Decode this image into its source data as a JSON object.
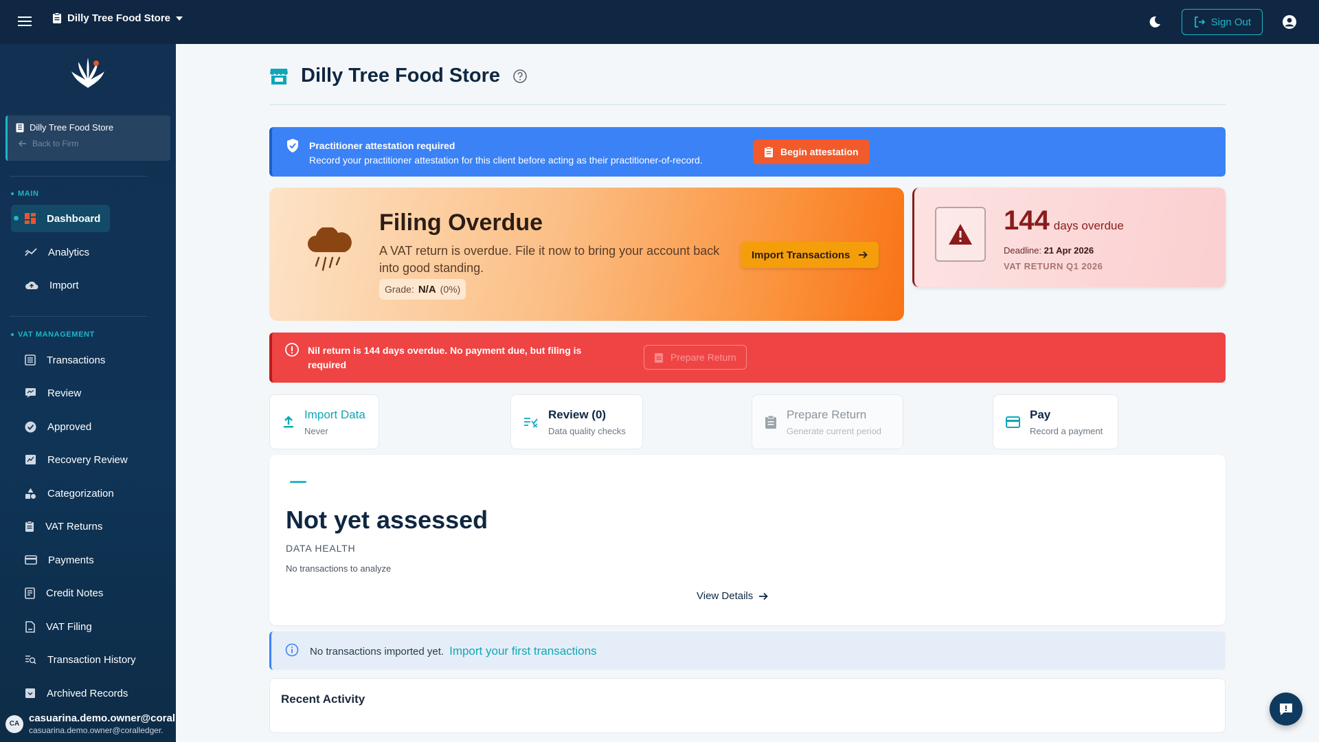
{
  "topbar": {
    "store_name": "Dilly Tree Food Store",
    "sign_out_label": "Sign Out"
  },
  "sidebar": {
    "client_name": "Dilly Tree Food Store",
    "back_label": "Back to Firm",
    "main_section": "MAIN",
    "main_items": [
      {
        "label": "Dashboard",
        "icon": "dashboard-icon"
      },
      {
        "label": "Analytics",
        "icon": "analytics-icon"
      },
      {
        "label": "Import",
        "icon": "cloud-upload-icon"
      }
    ],
    "vat_section": "VAT MANAGEMENT",
    "vat_items": [
      {
        "label": "Transactions",
        "icon": "list-icon"
      },
      {
        "label": "Review",
        "icon": "review-icon"
      },
      {
        "label": "Approved",
        "icon": "check-circle-icon"
      },
      {
        "label": "Recovery Review",
        "icon": "recovery-icon"
      },
      {
        "label": "Categorization",
        "icon": "category-icon"
      },
      {
        "label": "VAT Returns",
        "icon": "clipboard-icon"
      },
      {
        "label": "Payments",
        "icon": "card-icon"
      },
      {
        "label": "Credit Notes",
        "icon": "receipt-icon"
      },
      {
        "label": "VAT Filing",
        "icon": "filing-icon"
      },
      {
        "label": "Transaction History",
        "icon": "history-icon"
      },
      {
        "label": "Archived Records",
        "icon": "archive-icon"
      }
    ],
    "user": {
      "initials": "CA",
      "name": "casuarina.demo.owner@coral",
      "email": "casuarina.demo.owner@coralledger."
    }
  },
  "page": {
    "title": "Dilly Tree Food Store"
  },
  "attestation": {
    "title": "Practitioner attestation required",
    "message": "Record your practitioner attestation for this client before acting as their practitioner-of-record.",
    "button": "Begin attestation"
  },
  "overdue": {
    "title": "Filing Overdue",
    "description": "A VAT return is overdue. File it now to bring your account back into good standing.",
    "grade_label": "Grade:",
    "grade_value": "N/A",
    "grade_pct": "(0%)",
    "button": "Import Transactions"
  },
  "days_card": {
    "days": "144",
    "days_label": "days overdue",
    "deadline_label": "Deadline:",
    "deadline_value": "21 Apr 2026",
    "period": "VAT RETURN Q1 2026"
  },
  "nil_banner": {
    "message": "Nil return is 144 days overdue. No payment due, but filing is required",
    "button": "Prepare Return"
  },
  "steps": [
    {
      "title": "Import Data",
      "subtitle": "Never",
      "icon": "upload-icon"
    },
    {
      "title": "Review (0)",
      "subtitle": "Data quality checks",
      "icon": "review-checks-icon"
    },
    {
      "title": "Prepare Return",
      "subtitle": "Generate current period",
      "icon": "clipboard-icon"
    },
    {
      "title": "Pay",
      "subtitle": "Record a payment",
      "icon": "card-icon"
    }
  ],
  "health": {
    "status": "Not yet assessed",
    "label": "DATA HEALTH",
    "subtitle": "No transactions to analyze",
    "link": "View Details"
  },
  "info_banner": {
    "message": "No transactions imported yet.",
    "link": "Import your first transactions"
  },
  "activity": {
    "title": "Recent Activity"
  },
  "colors": {
    "navy": "#0f2742",
    "teal": "#1fb6c8",
    "blue_banner": "#3b82f6",
    "red_banner": "#ef4444",
    "orange_button": "#f15a2a",
    "amber_button": "#f59e0b"
  }
}
